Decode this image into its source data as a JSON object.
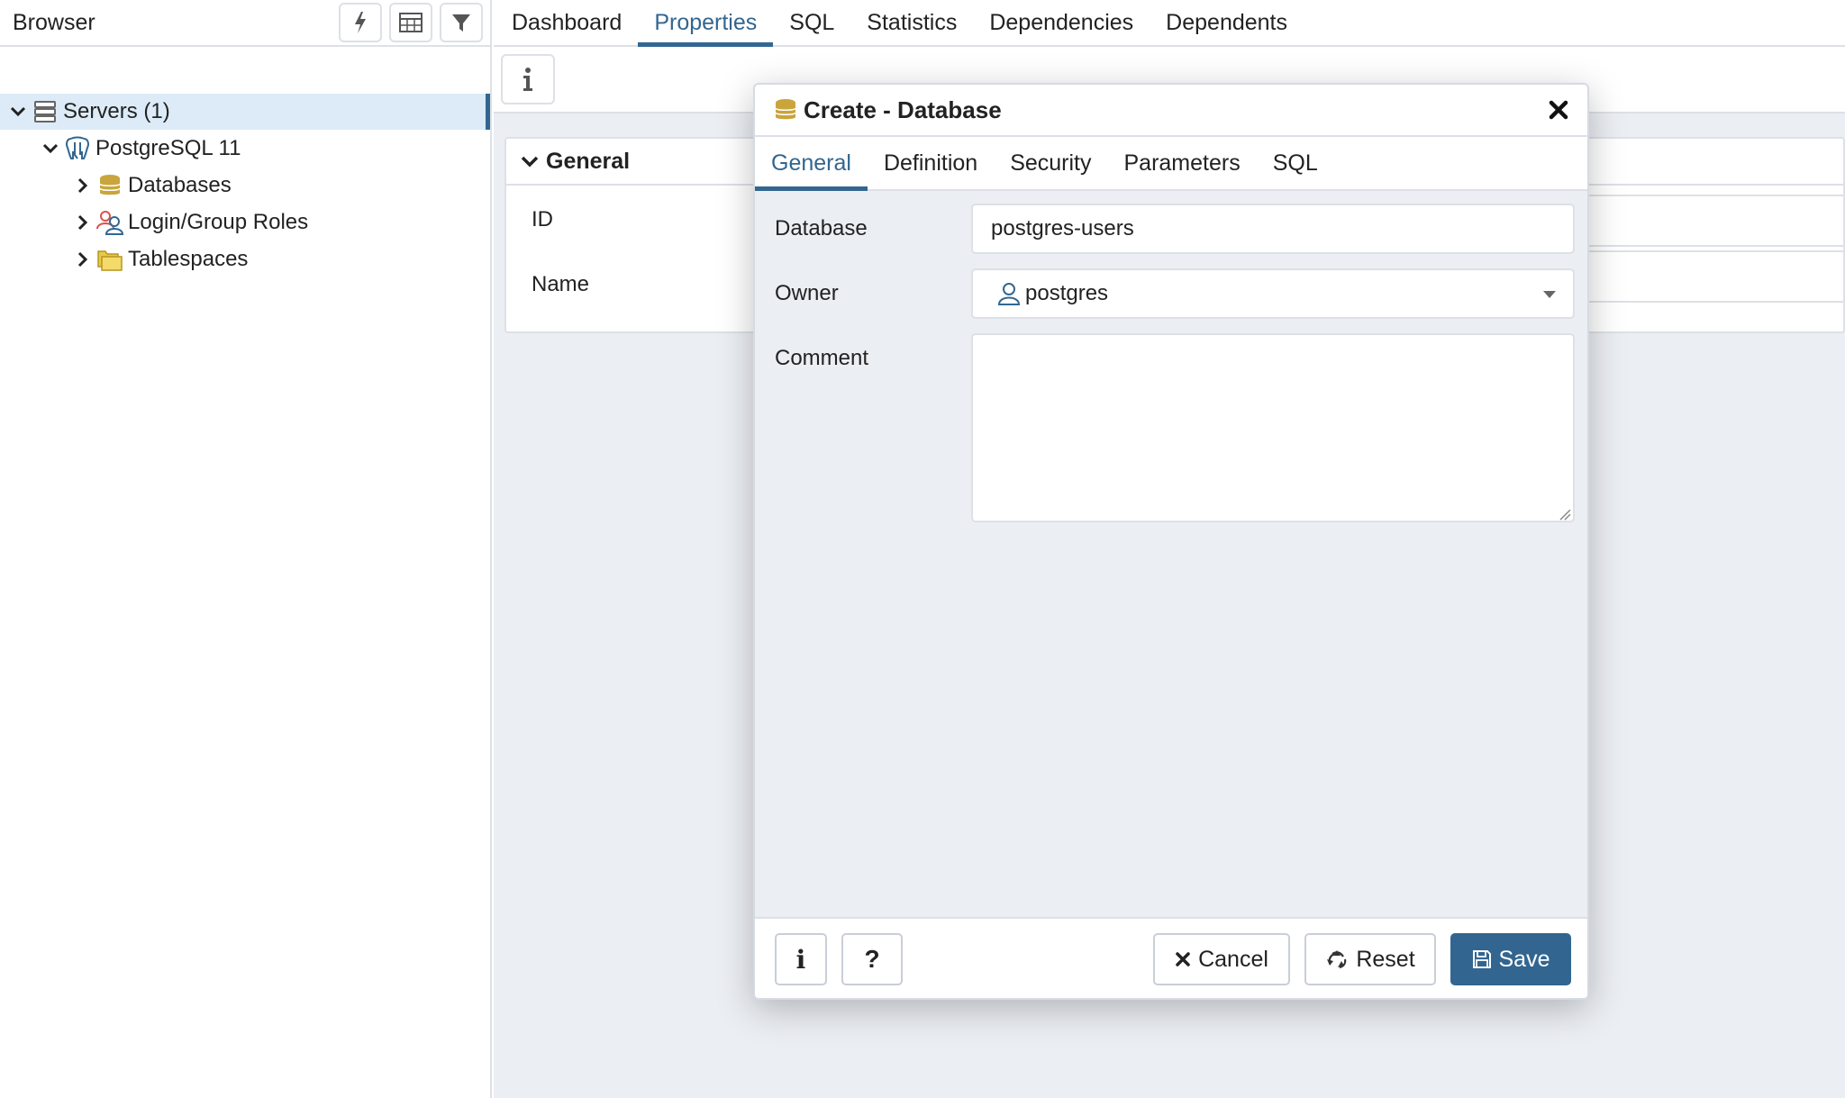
{
  "browser": {
    "title": "Browser",
    "tree": [
      {
        "label": "Servers (1)"
      },
      {
        "label": "PostgreSQL 11"
      },
      {
        "label": "Databases"
      },
      {
        "label": "Login/Group Roles"
      },
      {
        "label": "Tablespaces"
      }
    ]
  },
  "main_tabs": [
    "Dashboard",
    "Properties",
    "SQL",
    "Statistics",
    "Dependencies",
    "Dependents"
  ],
  "properties": {
    "section_title": "General",
    "fields": [
      "ID",
      "Name"
    ]
  },
  "dialog": {
    "title": "Create - Database",
    "tabs": [
      "General",
      "Definition",
      "Security",
      "Parameters",
      "SQL"
    ],
    "form": {
      "database_label": "Database",
      "database_value": "postgres-users",
      "owner_label": "Owner",
      "owner_value": "postgres",
      "comment_label": "Comment",
      "comment_value": ""
    },
    "buttons": {
      "info": "i",
      "help": "?",
      "cancel": "Cancel",
      "reset": "Reset",
      "save": "Save"
    }
  },
  "colors": {
    "accent": "#326690",
    "selected_row": "#dcebf7",
    "database_icon": "#c9a53c",
    "tablespace_icon": "#e8c948",
    "role_icon": "#d9534f"
  }
}
